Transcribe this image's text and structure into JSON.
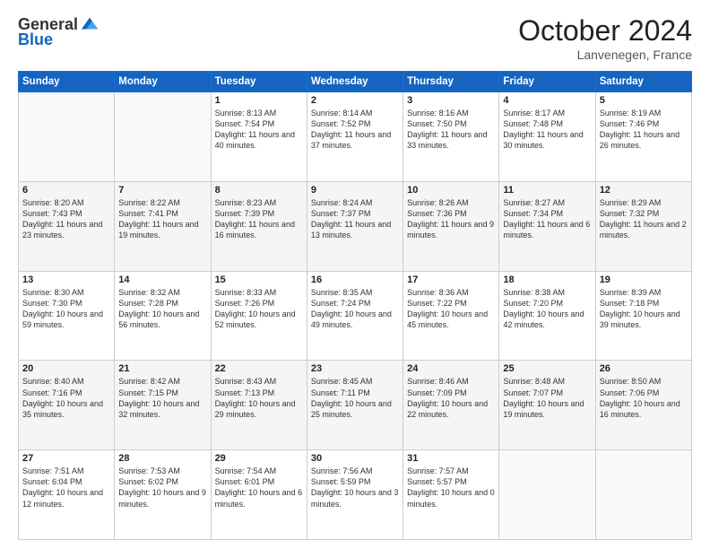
{
  "logo": {
    "general": "General",
    "blue": "Blue"
  },
  "header": {
    "month": "October 2024",
    "location": "Lanvenegen, France"
  },
  "days_of_week": [
    "Sunday",
    "Monday",
    "Tuesday",
    "Wednesday",
    "Thursday",
    "Friday",
    "Saturday"
  ],
  "weeks": [
    [
      {
        "day": "",
        "info": ""
      },
      {
        "day": "",
        "info": ""
      },
      {
        "day": "1",
        "info": "Sunrise: 8:13 AM\nSunset: 7:54 PM\nDaylight: 11 hours and 40 minutes."
      },
      {
        "day": "2",
        "info": "Sunrise: 8:14 AM\nSunset: 7:52 PM\nDaylight: 11 hours and 37 minutes."
      },
      {
        "day": "3",
        "info": "Sunrise: 8:16 AM\nSunset: 7:50 PM\nDaylight: 11 hours and 33 minutes."
      },
      {
        "day": "4",
        "info": "Sunrise: 8:17 AM\nSunset: 7:48 PM\nDaylight: 11 hours and 30 minutes."
      },
      {
        "day": "5",
        "info": "Sunrise: 8:19 AM\nSunset: 7:46 PM\nDaylight: 11 hours and 26 minutes."
      }
    ],
    [
      {
        "day": "6",
        "info": "Sunrise: 8:20 AM\nSunset: 7:43 PM\nDaylight: 11 hours and 23 minutes."
      },
      {
        "day": "7",
        "info": "Sunrise: 8:22 AM\nSunset: 7:41 PM\nDaylight: 11 hours and 19 minutes."
      },
      {
        "day": "8",
        "info": "Sunrise: 8:23 AM\nSunset: 7:39 PM\nDaylight: 11 hours and 16 minutes."
      },
      {
        "day": "9",
        "info": "Sunrise: 8:24 AM\nSunset: 7:37 PM\nDaylight: 11 hours and 13 minutes."
      },
      {
        "day": "10",
        "info": "Sunrise: 8:26 AM\nSunset: 7:36 PM\nDaylight: 11 hours and 9 minutes."
      },
      {
        "day": "11",
        "info": "Sunrise: 8:27 AM\nSunset: 7:34 PM\nDaylight: 11 hours and 6 minutes."
      },
      {
        "day": "12",
        "info": "Sunrise: 8:29 AM\nSunset: 7:32 PM\nDaylight: 11 hours and 2 minutes."
      }
    ],
    [
      {
        "day": "13",
        "info": "Sunrise: 8:30 AM\nSunset: 7:30 PM\nDaylight: 10 hours and 59 minutes."
      },
      {
        "day": "14",
        "info": "Sunrise: 8:32 AM\nSunset: 7:28 PM\nDaylight: 10 hours and 56 minutes."
      },
      {
        "day": "15",
        "info": "Sunrise: 8:33 AM\nSunset: 7:26 PM\nDaylight: 10 hours and 52 minutes."
      },
      {
        "day": "16",
        "info": "Sunrise: 8:35 AM\nSunset: 7:24 PM\nDaylight: 10 hours and 49 minutes."
      },
      {
        "day": "17",
        "info": "Sunrise: 8:36 AM\nSunset: 7:22 PM\nDaylight: 10 hours and 45 minutes."
      },
      {
        "day": "18",
        "info": "Sunrise: 8:38 AM\nSunset: 7:20 PM\nDaylight: 10 hours and 42 minutes."
      },
      {
        "day": "19",
        "info": "Sunrise: 8:39 AM\nSunset: 7:18 PM\nDaylight: 10 hours and 39 minutes."
      }
    ],
    [
      {
        "day": "20",
        "info": "Sunrise: 8:40 AM\nSunset: 7:16 PM\nDaylight: 10 hours and 35 minutes."
      },
      {
        "day": "21",
        "info": "Sunrise: 8:42 AM\nSunset: 7:15 PM\nDaylight: 10 hours and 32 minutes."
      },
      {
        "day": "22",
        "info": "Sunrise: 8:43 AM\nSunset: 7:13 PM\nDaylight: 10 hours and 29 minutes."
      },
      {
        "day": "23",
        "info": "Sunrise: 8:45 AM\nSunset: 7:11 PM\nDaylight: 10 hours and 25 minutes."
      },
      {
        "day": "24",
        "info": "Sunrise: 8:46 AM\nSunset: 7:09 PM\nDaylight: 10 hours and 22 minutes."
      },
      {
        "day": "25",
        "info": "Sunrise: 8:48 AM\nSunset: 7:07 PM\nDaylight: 10 hours and 19 minutes."
      },
      {
        "day": "26",
        "info": "Sunrise: 8:50 AM\nSunset: 7:06 PM\nDaylight: 10 hours and 16 minutes."
      }
    ],
    [
      {
        "day": "27",
        "info": "Sunrise: 7:51 AM\nSunset: 6:04 PM\nDaylight: 10 hours and 12 minutes."
      },
      {
        "day": "28",
        "info": "Sunrise: 7:53 AM\nSunset: 6:02 PM\nDaylight: 10 hours and 9 minutes."
      },
      {
        "day": "29",
        "info": "Sunrise: 7:54 AM\nSunset: 6:01 PM\nDaylight: 10 hours and 6 minutes."
      },
      {
        "day": "30",
        "info": "Sunrise: 7:56 AM\nSunset: 5:59 PM\nDaylight: 10 hours and 3 minutes."
      },
      {
        "day": "31",
        "info": "Sunrise: 7:57 AM\nSunset: 5:57 PM\nDaylight: 10 hours and 0 minutes."
      },
      {
        "day": "",
        "info": ""
      },
      {
        "day": "",
        "info": ""
      }
    ]
  ]
}
